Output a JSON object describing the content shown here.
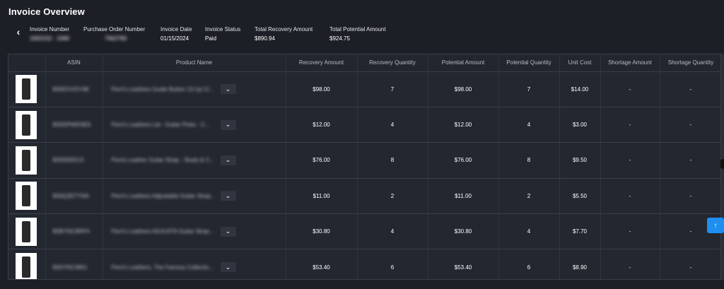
{
  "page_title": "Invoice Overview",
  "meta": [
    {
      "label": "Invoice Number",
      "value": "1002152 - 1560"
    },
    {
      "label": "Purchase Order Number",
      "value": "7562783"
    },
    {
      "label": "Invoice Date",
      "value": "01/15/2024"
    },
    {
      "label": "Invoice Status",
      "value": "Paid"
    },
    {
      "label": "Total Recovery Amount",
      "value": "$890.94"
    },
    {
      "label": "Total Potential Amount",
      "value": "$924.75"
    }
  ],
  "table": {
    "headers": [
      "",
      "ASIN",
      "Product Name",
      "Recovery Amount",
      "Recovery Quantity",
      "Potential Amount",
      "Potential Quantity",
      "Unit Cost",
      "Shortage Amount",
      "Shortage Quantity"
    ],
    "rows": [
      {
        "asin": "B00EXVDY4B",
        "name": "Perri's Leathers Guide Button 13 Up Cl...",
        "recovery_amount": "$98.00",
        "recovery_qty": "7",
        "potential_amount": "$98.00",
        "potential_qty": "7",
        "unit_cost": "$14.00",
        "shortage_amount": "-",
        "shortage_qty": "-"
      },
      {
        "asin": "B00DPWKNE6",
        "name": "Perri's Leathers Ltd - Guitar Picks - C...",
        "recovery_amount": "$12.00",
        "recovery_qty": "4",
        "potential_amount": "$12.00",
        "potential_qty": "4",
        "unit_cost": "$3.00",
        "shortage_amount": "-",
        "shortage_qty": "-"
      },
      {
        "asin": "B0060EEC0",
        "name": "Perris Leather Guitar Strap - Studs & C...",
        "recovery_amount": "$76.00",
        "recovery_qty": "8",
        "potential_amount": "$76.00",
        "potential_qty": "8",
        "unit_cost": "$9.50",
        "shortage_amount": "-",
        "shortage_qty": "-"
      },
      {
        "asin": "B00Q3D7YNA",
        "name": "Perri's Leathers Adjustable Guitar Strap...",
        "recovery_amount": "$11.00",
        "recovery_qty": "2",
        "potential_amount": "$11.00",
        "potential_qty": "2",
        "unit_cost": "$5.50",
        "shortage_amount": "-",
        "shortage_qty": "-"
      },
      {
        "asin": "B0BYNC8RP4",
        "name": "Perri's Leathers ADJUSTA Guitar Strap...",
        "recovery_amount": "$30.80",
        "recovery_qty": "4",
        "potential_amount": "$30.80",
        "potential_qty": "4",
        "unit_cost": "$7.70",
        "shortage_amount": "-",
        "shortage_qty": "-"
      },
      {
        "asin": "B00YNC4801",
        "name": "Perri's Leathers, The Famous Collectio...",
        "recovery_amount": "$53.40",
        "recovery_qty": "6",
        "potential_amount": "$53.40",
        "potential_qty": "6",
        "unit_cost": "$8.90",
        "shortage_amount": "-",
        "shortage_qty": "-"
      }
    ]
  },
  "icons": {
    "back": "chevron-left-icon",
    "dropdown": "chevron-down-icon",
    "scroll_top": "arrow-up-icon"
  },
  "colors": {
    "background": "#1c1f26",
    "accent": "#1e8ff0"
  }
}
